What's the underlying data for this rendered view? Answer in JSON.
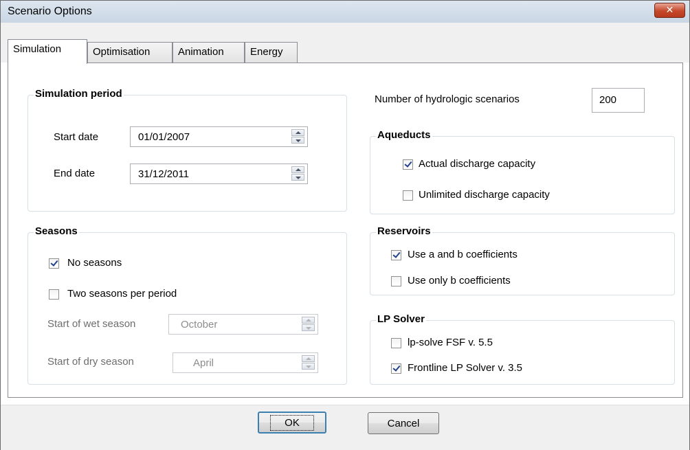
{
  "window": {
    "title": "Scenario Options",
    "close_glyph": "✕"
  },
  "tabs": [
    {
      "label": "Simulation"
    },
    {
      "label": "Optimisation"
    },
    {
      "label": "Animation"
    },
    {
      "label": "Energy"
    }
  ],
  "simulation_period": {
    "legend": "Simulation period",
    "start_label": "Start date",
    "start_value": "01/01/2007",
    "end_label": "End date",
    "end_value": "31/12/2011"
  },
  "seasons": {
    "legend": "Seasons",
    "no_seasons_label": "No seasons",
    "no_seasons_checked": true,
    "two_seasons_label": "Two seasons per period",
    "two_seasons_checked": false,
    "wet_label": "Start of wet season",
    "wet_value": "October",
    "dry_label": "Start of dry season",
    "dry_value": "April"
  },
  "hydrologic": {
    "label": "Number of hydrologic scenarios",
    "value": "200"
  },
  "aqueducts": {
    "legend": "Aqueducts",
    "actual_label": "Actual discharge capacity",
    "actual_checked": true,
    "unlimited_label": "Unlimited discharge capacity",
    "unlimited_checked": false
  },
  "reservoirs": {
    "legend": "Reservoirs",
    "ab_label": "Use a and b coefficients",
    "ab_checked": true,
    "b_label": "Use only b coefficients",
    "b_checked": false
  },
  "lp_solver": {
    "legend": "LP Solver",
    "lpsolve_label": "lp-solve FSF v. 5.5",
    "lpsolve_checked": false,
    "frontline_label": "Frontline LP Solver v. 3.5",
    "frontline_checked": true
  },
  "buttons": {
    "ok": "OK",
    "cancel": "Cancel"
  },
  "colors": {
    "titlebar": "#c9d6e4",
    "close": "#c5482b",
    "accent": "#3c7fb1"
  }
}
